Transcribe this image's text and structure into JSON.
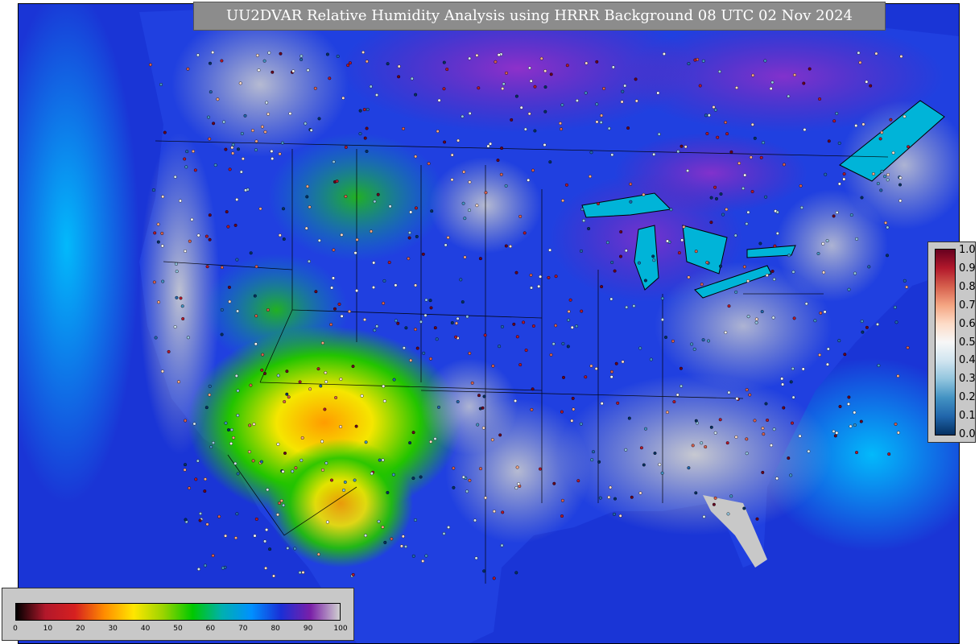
{
  "map": {
    "title": "UU2DVAR Relative Humidity Analysis using HRRR Background 08 UTC 02 Nov 2024",
    "base_colors": {
      "ocean": "#1a35d6",
      "ocean_light": "#00b4ff",
      "land_moist": "#c8c8c8",
      "purple": "#7a1fa8",
      "green": "#22c400",
      "yellow": "#f5e600",
      "orange": "#ff9c00",
      "lake": "#00b4d8"
    }
  },
  "obs_legend": {
    "ticks": [
      "1.0",
      "0.9",
      "0.8",
      "0.7",
      "0.6",
      "0.5",
      "0.4",
      "0.3",
      "0.2",
      "0.1",
      "0.0"
    ],
    "colors": [
      "#67001f",
      "#b2182b",
      "#d6604d",
      "#f4a582",
      "#fddbc7",
      "#f7f7f7",
      "#d1e5f0",
      "#92c5de",
      "#4393c3",
      "#2166ac",
      "#053061"
    ]
  },
  "rh_legend": {
    "ticks": [
      "0",
      "10",
      "20",
      "30",
      "40",
      "50",
      "60",
      "70",
      "80",
      "90",
      "100"
    ],
    "colors": [
      "#000000",
      "#b2182b",
      "#d62020",
      "#ff8c00",
      "#ffe600",
      "#9ad400",
      "#00c800",
      "#00b0b0",
      "#0090ff",
      "#1a2fd6",
      "#7a1fa8",
      "#d0d0d0"
    ]
  }
}
